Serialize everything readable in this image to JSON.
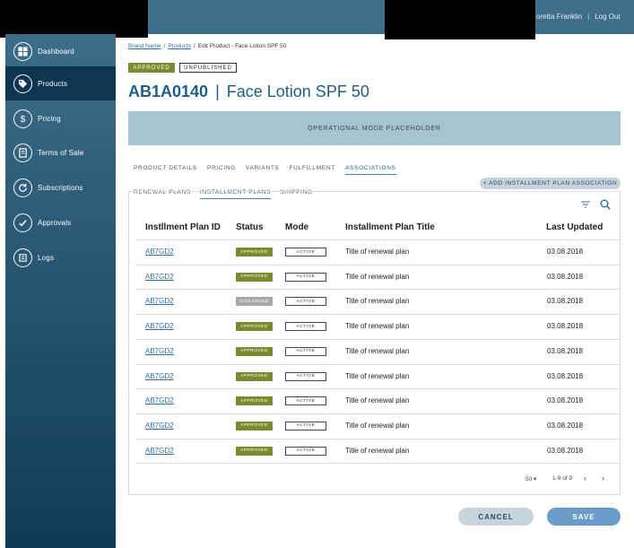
{
  "header": {
    "user_name": "oretta Franklin",
    "separator": "|",
    "logout": "Log Out"
  },
  "sidebar": {
    "items": [
      {
        "label": "Dashboard",
        "icon": "dashboard-icon"
      },
      {
        "label": "Products",
        "icon": "tag-icon",
        "active": true
      },
      {
        "label": "Pricing",
        "icon": "dollar-icon"
      },
      {
        "label": "Terms of Sale",
        "icon": "document-icon"
      },
      {
        "label": "Subscriptions",
        "icon": "refresh-icon"
      },
      {
        "label": "Approvals",
        "icon": "check-icon"
      },
      {
        "label": "Logs",
        "icon": "list-icon"
      }
    ]
  },
  "breadcrumb": {
    "brand": "Brand Name",
    "products": "Products",
    "current": "Edit Product - Face Lotion SPF 50",
    "sep": "/"
  },
  "badges": {
    "approved": "APPROVED",
    "unpublished": "UNPUBLISHED"
  },
  "product": {
    "code": "AB1A0140",
    "bar": "|",
    "name": "Face Lotion SPF 50"
  },
  "operational_mode": "OPERATIONAL MODE PLACEHOLDER",
  "tabs": [
    "PRODUCT DETAILS",
    "PRICING",
    "VARIANTS",
    "FULFILLMENT",
    "ASSOCIATIONS"
  ],
  "subtabs": [
    "RENEWAL PLANS",
    "INSTALLMENT PLANS",
    "SHIPPING"
  ],
  "add_button": "+ ADD INSTALLMENT PLAN ASSOCIATION",
  "table": {
    "headers": [
      "Instllment Plan ID",
      "Status",
      "Mode",
      "Installment Plan Title",
      "Last Updated"
    ],
    "rows": [
      {
        "id": "AB7GD2",
        "status": "APPROVED",
        "mode": "ACTIVE",
        "title": "Title of renewal plan",
        "updated": "03.08.2018"
      },
      {
        "id": "AB7GD2",
        "status": "APPROVED",
        "mode": "ACTIVE",
        "title": "Title of renewal plan",
        "updated": "03.08.2018"
      },
      {
        "id": "AB7GD2",
        "status": "DISCARDED",
        "mode": "ACTIVE",
        "title": "Title of renewal plan",
        "updated": "03.08.2018"
      },
      {
        "id": "AB7GD2",
        "status": "APPROVED",
        "mode": "ACTIVE",
        "title": "Title of renewal plan",
        "updated": "03.08.2018"
      },
      {
        "id": "AB7GD2",
        "status": "APPROVED",
        "mode": "ACTIVE",
        "title": "Title of renewal plan",
        "updated": "03.08.2018"
      },
      {
        "id": "AB7GD2",
        "status": "APPROVED",
        "mode": "ACTIVE",
        "title": "Title of renewal plan",
        "updated": "03.08.2018"
      },
      {
        "id": "AB7GD2",
        "status": "APPROVED",
        "mode": "ACTIVE",
        "title": "Title of renewal plan",
        "updated": "03.08.2018"
      },
      {
        "id": "AB7GD2",
        "status": "APPROVED",
        "mode": "ACTIVE",
        "title": "Title of renewal plan",
        "updated": "03.08.2018"
      },
      {
        "id": "AB7GD2",
        "status": "APPROVED",
        "mode": "ACTIVE",
        "title": "Title of renewal plan",
        "updated": "03.08.2018"
      }
    ]
  },
  "pagination": {
    "per_page": "50",
    "range": "1-9 of 9"
  },
  "actions": {
    "cancel": "CANCEL",
    "save": "SAVE"
  },
  "colors": {
    "approved": "#7a8a2f",
    "discarded": "#a8a8a8",
    "accent": "#1e5f87",
    "sidebar": "#0f3b58"
  }
}
